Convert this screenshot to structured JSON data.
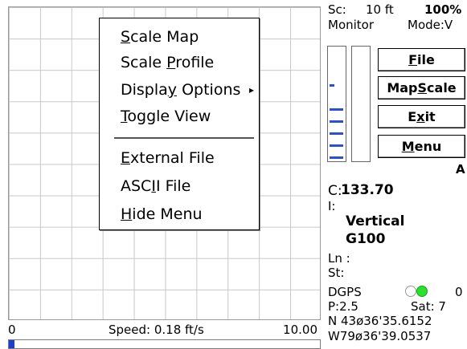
{
  "map": {
    "speed_min": "0",
    "speed_text": "Speed: 0.18 ft/s",
    "speed_max": "10.00",
    "speed_fraction": 0.018
  },
  "menu": {
    "items": [
      {
        "pre": "",
        "mnemonic": "S",
        "post": "cale Map"
      },
      {
        "pre": "Scale ",
        "mnemonic": "P",
        "post": "rofile"
      },
      {
        "pre": "Displa",
        "mnemonic": "y",
        "post": " Options"
      },
      {
        "pre": "",
        "mnemonic": "T",
        "post": "oggle View"
      },
      {
        "pre": "",
        "mnemonic": "E",
        "post": "xternal File"
      },
      {
        "pre": "ASC",
        "mnemonic": "I",
        "post": "I File"
      },
      {
        "pre": "",
        "mnemonic": "H",
        "post": "ide Menu"
      }
    ],
    "submenu_arrow": "▸"
  },
  "panel": {
    "scale_label": "Sc:",
    "scale_value": "10 ft",
    "percent": "100%",
    "monitor_label": "Monitor",
    "mode_label": "Mode:V",
    "gauge_left_level": 0.45,
    "gauge_right_level": 0.0,
    "buttons": {
      "file": {
        "pre": "",
        "mnemonic": "F",
        "post": "ile"
      },
      "mapscale": {
        "pre": "Map",
        "mnemonic": "S",
        "post": "cale"
      },
      "exit": {
        "pre": "E",
        "mnemonic": "x",
        "post": "it"
      },
      "menu": {
        "pre": "",
        "mnemonic": "M",
        "post": "enu"
      }
    },
    "flag": "A",
    "c_label": "C:",
    "c_value": "133.70",
    "i_label": "I:",
    "i_line1": "Vertical",
    "i_line2": "G100",
    "ln_label": "Ln :",
    "st_label": "St:",
    "dgps_label": "DGPS",
    "dgps_value": "0",
    "p_label": "P:2.5",
    "sat_label": "Sat: 7",
    "north": "N 43ø36'35.6152",
    "west": "W79ø36'39.0537"
  }
}
